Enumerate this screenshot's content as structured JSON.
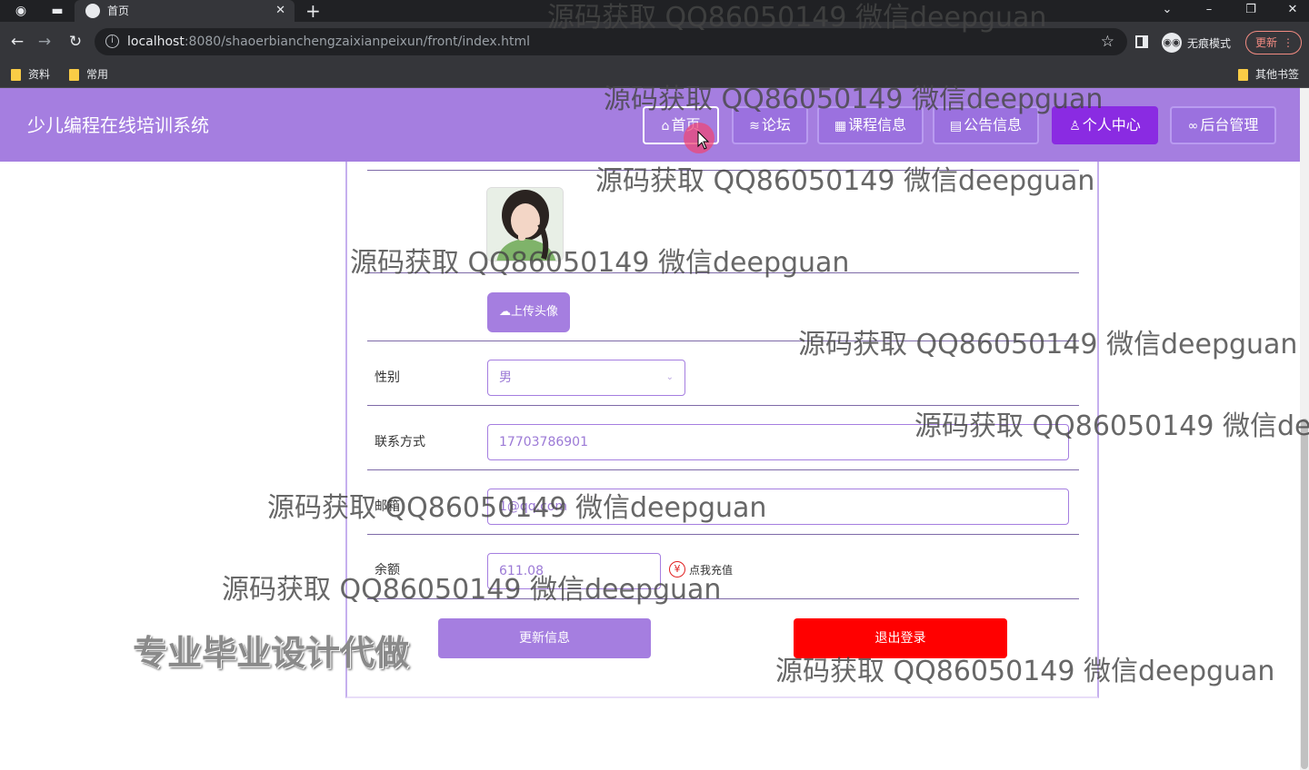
{
  "browser": {
    "tab_title": "首页",
    "url_host": "localhost",
    "url_rest": ":8080/shaoerbianchengzaixianpeixun/front/index.html",
    "incognito_label": "无痕模式",
    "update_label": "更新",
    "bookmarks": [
      "资料",
      "常用"
    ],
    "other_bookmarks": "其他书签"
  },
  "site": {
    "title": "少儿编程在线培训系统",
    "nav": [
      {
        "label": "首页",
        "icon": "home-icon"
      },
      {
        "label": "论坛",
        "icon": "layers-icon"
      },
      {
        "label": "课程信息",
        "icon": "grid-icon"
      },
      {
        "label": "公告信息",
        "icon": "notice-icon"
      },
      {
        "label": "个人中心",
        "icon": "user-icon"
      },
      {
        "label": "后台管理",
        "icon": "link-icon"
      }
    ]
  },
  "profile": {
    "upload_label": "上传头像",
    "gender_label": "性别",
    "gender_value": "男",
    "phone_label": "联系方式",
    "phone_value": "17703786901",
    "email_label": "邮箱",
    "email_value": "1@qq.com",
    "balance_label": "余额",
    "balance_value": "611.08",
    "recharge_label": "点我充值",
    "update_label": "更新信息",
    "logout_label": "退出登录"
  },
  "watermarks": {
    "text": "源码获取 QQ86050149 微信deepguan",
    "text_cut": "源码获取 QQ86050149 微信dee",
    "stamp": "专业毕业设计代做"
  },
  "colors": {
    "primary": "#a57ee0",
    "active_nav": "#8a2be2",
    "danger": "#ff0000"
  }
}
